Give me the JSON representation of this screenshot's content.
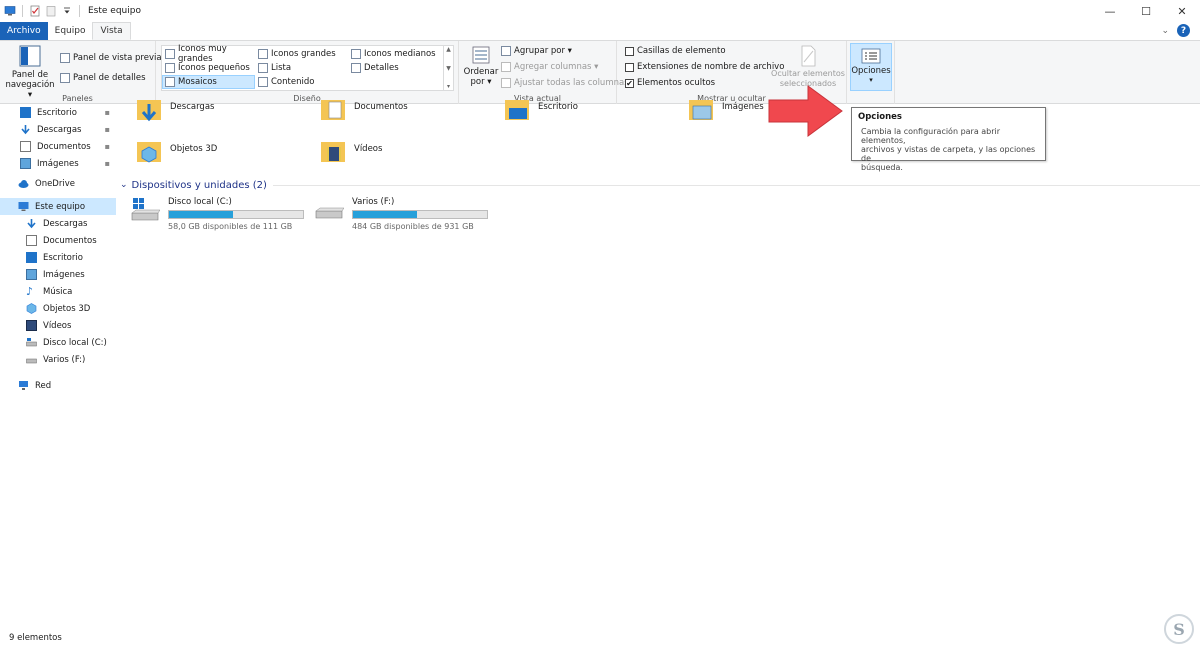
{
  "window": {
    "title": "Este equipo",
    "minimize": "—",
    "maximize": "☐",
    "close": "✕"
  },
  "ribbon_tabs": {
    "file": "Archivo",
    "computer": "Equipo",
    "view": "Vista",
    "collapse": "⌄"
  },
  "panes_group": {
    "label": "Paneles",
    "navigation_pane_line1": "Panel de",
    "navigation_pane_line2": "navegación ▾",
    "preview_pane": "Panel de vista previa",
    "details_pane": "Panel de detalles"
  },
  "layout_group": {
    "label": "Diseño",
    "extra_large_icons": "Iconos muy grandes",
    "large_icons": "Iconos grandes",
    "medium_icons": "Iconos medianos",
    "small_icons": "Iconos pequeños",
    "list": "Lista",
    "details": "Detalles",
    "tiles": "Mosaicos",
    "content": "Contenido",
    "selected": "Mosaicos"
  },
  "current_view_group": {
    "label": "Vista actual",
    "sort_by_line1": "Ordenar",
    "sort_by_line2": "por ▾",
    "group_by": "Agrupar por ▾",
    "add_columns": "Agregar columnas ▾",
    "size_all_columns": "Ajustar todas las columnas"
  },
  "show_hide_group": {
    "label": "Mostrar u ocultar",
    "item_checkboxes": "Casillas de elemento",
    "item_checkboxes_checked": false,
    "file_name_extensions": "Extensiones de nombre de archivo",
    "file_name_extensions_checked": false,
    "hidden_items": "Elementos ocultos",
    "hidden_items_checked": true,
    "hide_selected_line1": "Ocultar elementos",
    "hide_selected_line2": "seleccionados"
  },
  "options_group": {
    "label": "Opciones",
    "arrow": "▾"
  },
  "tooltip": {
    "title": "Opciones",
    "line1": "Cambia la configuración para abrir elementos,",
    "line2": "archivos y vistas de carpeta, y las opciones de",
    "line3": "búsqueda."
  },
  "nav": {
    "quick_access": [
      {
        "label": "Escritorio",
        "pinned": true
      },
      {
        "label": "Descargas",
        "pinned": true
      },
      {
        "label": "Documentos",
        "pinned": true
      },
      {
        "label": "Imágenes",
        "pinned": true
      }
    ],
    "onedrive": "OneDrive",
    "this_pc": "Este equipo",
    "this_pc_items": [
      "Descargas",
      "Documentos",
      "Escritorio",
      "Imágenes",
      "Música",
      "Objetos 3D",
      "Vídeos",
      "Disco local (C:)",
      "Varios (F:)"
    ],
    "network": "Red",
    "pin_glyph": "📌"
  },
  "folders": [
    {
      "label": "Descargas"
    },
    {
      "label": "Documentos"
    },
    {
      "label": "Escritorio"
    },
    {
      "label": "Imágenes"
    },
    {
      "label": "Objetos 3D"
    },
    {
      "label": "Vídeos"
    }
  ],
  "devices_section": {
    "title": "Dispositivos y unidades (2)",
    "chevron": "⌄"
  },
  "drives": [
    {
      "name": "Disco local (C:)",
      "free": "58,0 GB disponibles de 111 GB",
      "used_fraction": 0.48
    },
    {
      "name": "Varios (F:)",
      "free": "484 GB disponibles de 931 GB",
      "used_fraction": 0.48
    }
  ],
  "status": {
    "item_count": "9 elementos"
  },
  "colors": {
    "accent": "#1a63b8",
    "arrow": "#f0484e",
    "selection": "#cce8ff",
    "drive_bar": "#26a0da",
    "folder": "#f4c554"
  }
}
